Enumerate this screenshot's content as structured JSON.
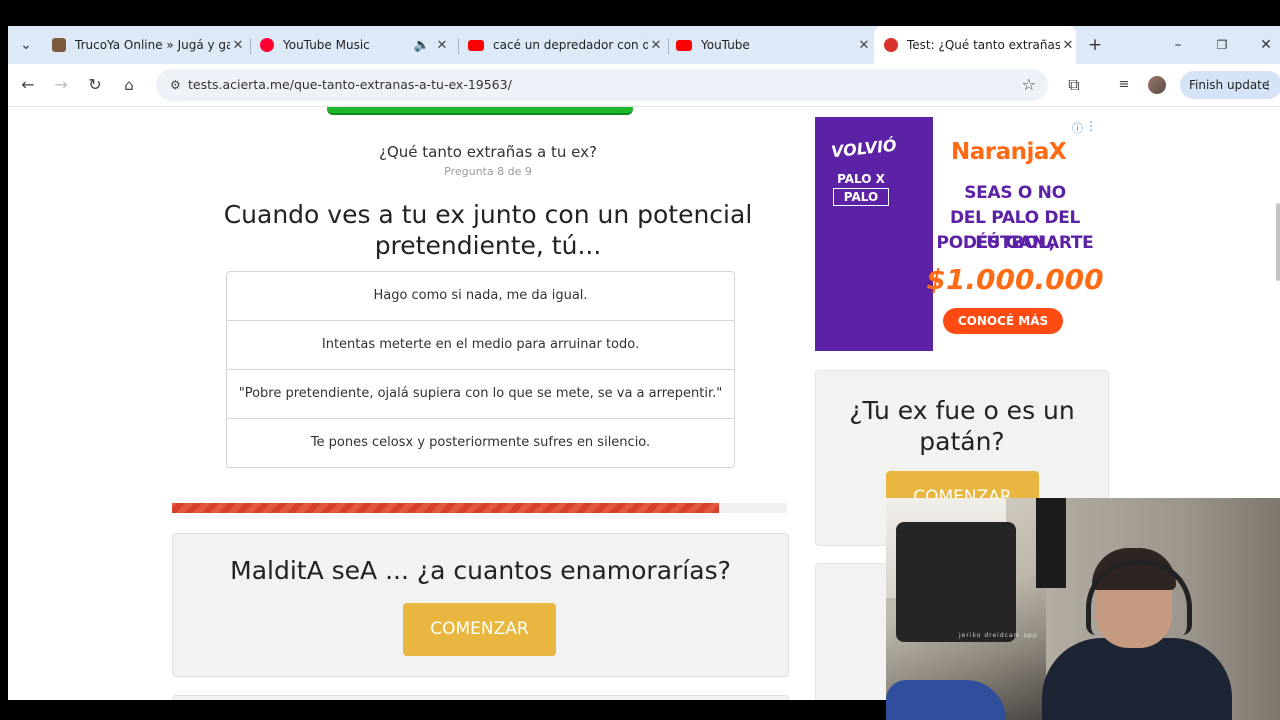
{
  "browser": {
    "tabs": [
      {
        "title": "TrucoYa Online » Jugá y ganá",
        "icon_color": "#7a5a3a"
      },
      {
        "title": "YouTube Music",
        "icon_color": "#ff0033"
      },
      {
        "title": "cacé un depredador con disfraz",
        "icon_color": "#ff0000"
      },
      {
        "title": "YouTube",
        "icon_color": "#ff0000"
      },
      {
        "title": "Test: ¿Qué tanto extrañas a tu ex?",
        "icon_color": "#d9312b"
      }
    ],
    "url": "tests.acierta.me/que-tanto-extranas-a-tu-ex-19563/",
    "finish_update": "Finish update"
  },
  "quiz": {
    "title": "¿Qué tanto extrañas a tu ex?",
    "step": "Pregunta 8 de 9",
    "question": "Cuando ves a tu ex junto con un potencial pretendiente, tú...",
    "answers": [
      "Hago como si nada, me da igual.",
      "Intentas meterte en el medio para arruinar todo.",
      "\"Pobre pretendiente, ojalá supiera con lo que se mete, se va a arrepentir.\"",
      "Te pones celosx y posteriormente sufres en silencio."
    ],
    "progress": 0.89
  },
  "promo": {
    "title": "MalditA seA ... ¿a cuantos enamorarías?",
    "button": "COMENZAR"
  },
  "ad": {
    "volvio": "VOLVIÓ",
    "palo1": "PALO X",
    "palo2": "PALO",
    "brand": "NaranjaX",
    "line1": "SEAS O NO",
    "line2": "DEL PALO DEL FÚTBOL,",
    "line3": "PODÉS GANARTE",
    "prize": "$1.000.000",
    "cta": "CONOCÉ MÁS",
    "accent": "#ff6a14",
    "purple": "#5b22a6"
  },
  "sidebar": {
    "title": "¿Tu ex fue o es un patán?",
    "button": "COMENZAR"
  },
  "webcam": {
    "watermark": "jeriko dreidcam.app"
  }
}
